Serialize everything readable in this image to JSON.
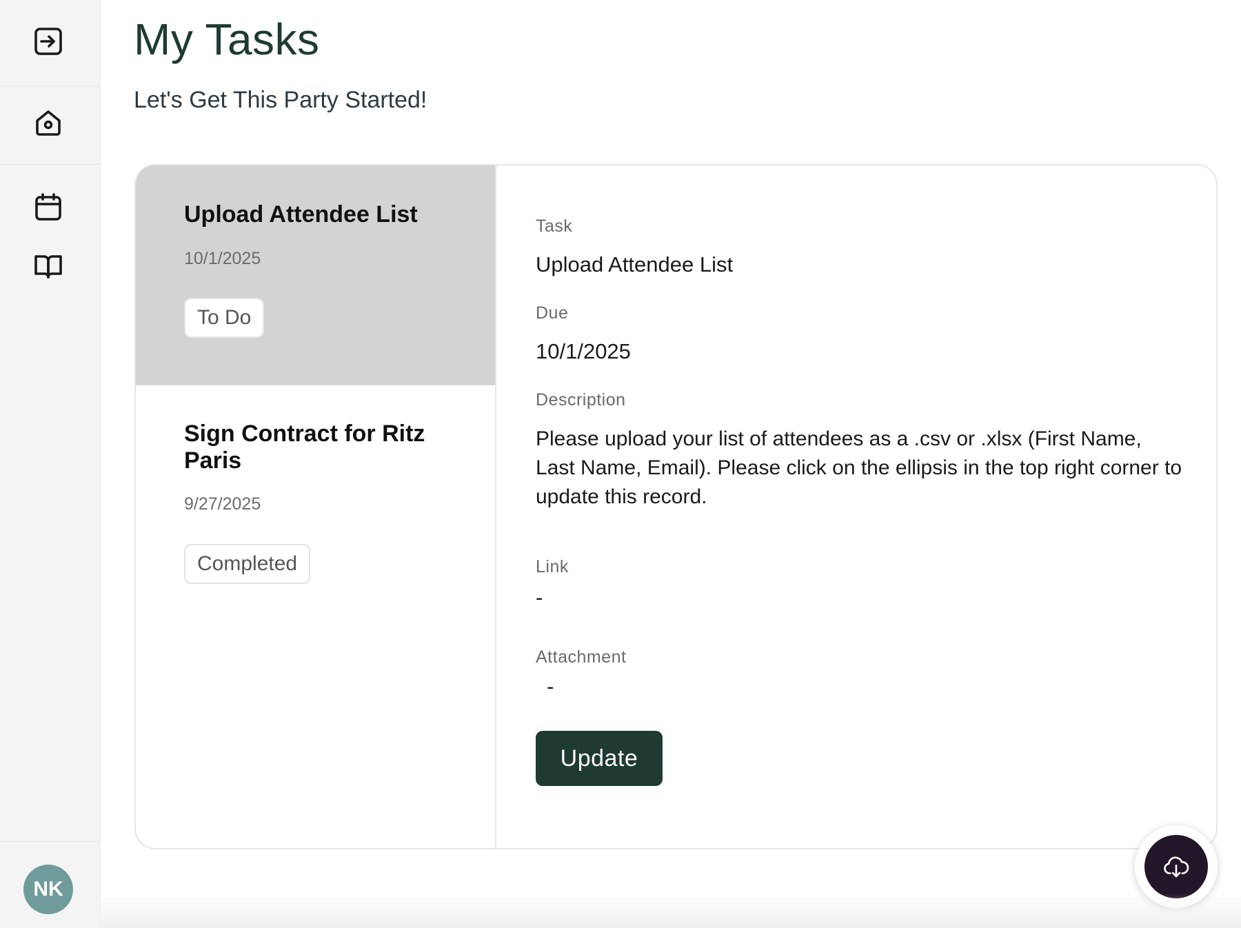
{
  "sidebar": {
    "icons": [
      "sign-out-icon",
      "home-icon",
      "calendar-icon",
      "book-icon"
    ],
    "avatar_initials": "NK",
    "avatar_color": "#6f9c9a"
  },
  "header": {
    "title": "My Tasks",
    "subtitle": "Let's Get This Party Started!"
  },
  "tasks": [
    {
      "name": "Upload Attendee List",
      "date": "10/1/2025",
      "status": "To Do",
      "selected": true
    },
    {
      "name": "Sign Contract for Ritz Paris",
      "date": "9/27/2025",
      "status": "Completed",
      "selected": false
    }
  ],
  "detail": {
    "task_label": "Task",
    "task_value": "Upload Attendee List",
    "due_label": "Due",
    "due_value": "10/1/2025",
    "description_label": "Description",
    "description_value": "Please upload your list of attendees as a .csv or .xlsx (First Name, Last Name, Email). Please click on the ellipsis in the top right corner to update this record.",
    "link_label": "Link",
    "link_value": "-",
    "attachment_label": "Attachment",
    "attachment_value": "-",
    "update_label": "Update"
  },
  "fab": {
    "icon": "cloud-download-icon",
    "color": "#231628"
  },
  "colors": {
    "accent": "#1f3a33",
    "selected_row": "#d3d3d3"
  }
}
